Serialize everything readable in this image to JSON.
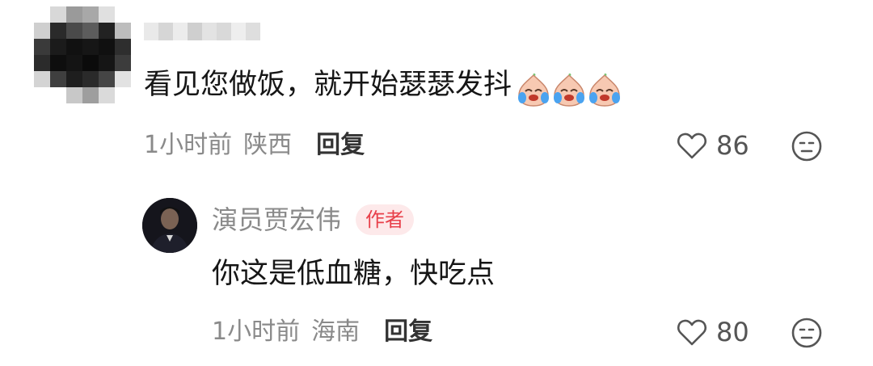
{
  "comment": {
    "text": "看见您做饭，就开始瑟瑟发抖",
    "emoji": [
      "crying-face-icon",
      "crying-face-icon",
      "crying-face-icon"
    ],
    "time": "1小时前",
    "location": "陕西",
    "reply_label": "回复",
    "likes": "86"
  },
  "reply": {
    "author": "演员贾宏伟",
    "badge": "作者",
    "text": "你这是低血糖，快吃点",
    "time": "1小时前",
    "location": "海南",
    "reply_label": "回复",
    "likes": "80"
  },
  "colors": {
    "badge_bg": "#fde9ea",
    "badge_text": "#e8404a",
    "meta_text": "#8a8a8a"
  }
}
